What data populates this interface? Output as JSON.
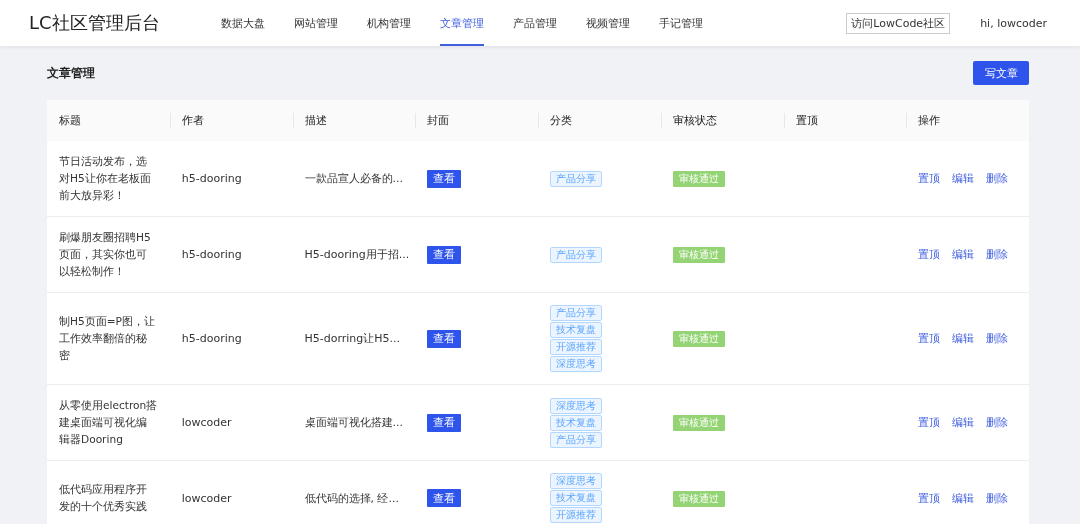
{
  "header": {
    "logo": "LC社区管理后台",
    "nav": [
      {
        "label": "数据大盘",
        "selected": false
      },
      {
        "label": "网站管理",
        "selected": false
      },
      {
        "label": "机构管理",
        "selected": false
      },
      {
        "label": "文章管理",
        "selected": true
      },
      {
        "label": "产品管理",
        "selected": false
      },
      {
        "label": "视频管理",
        "selected": false
      },
      {
        "label": "手记管理",
        "selected": false
      }
    ],
    "visit_button": "访问LowCode社区",
    "greeting": "hi, lowcoder"
  },
  "page": {
    "title": "文章管理",
    "write_button": "写文章"
  },
  "table": {
    "columns": [
      "标题",
      "作者",
      "描述",
      "封面",
      "分类",
      "审核状态",
      "置顶",
      "操作"
    ],
    "rows": [
      {
        "title": "节日活动发布，选对H5让你在老板面前大放异彩！",
        "author": "h5-dooring",
        "description": "一款品宣人必备的...",
        "cover": "查看",
        "categories": [
          "产品分享"
        ],
        "status": "审核通过",
        "actions": [
          "置顶",
          "编辑",
          "删除"
        ]
      },
      {
        "title": "刷爆朋友圈招聘H5页面，其实你也可以轻松制作！",
        "author": "h5-dooring",
        "description": "H5-dooring用于招...",
        "cover": "查看",
        "categories": [
          "产品分享"
        ],
        "status": "审核通过",
        "actions": [
          "置顶",
          "编辑",
          "删除"
        ]
      },
      {
        "title": "制H5页面=P图，让工作效率翻倍的秘密",
        "author": "h5-dooring",
        "description": "H5-dorring让H5...",
        "cover": "查看",
        "categories": [
          "产品分享",
          "技术复盘",
          "开源推荐",
          "深度思考"
        ],
        "status": "审核通过",
        "actions": [
          "置顶",
          "编辑",
          "删除"
        ]
      },
      {
        "title": "从零使用electron搭建桌面端可视化编辑器Dooring",
        "author": "lowcoder",
        "description": "桌面端可视化搭建...",
        "cover": "查看",
        "categories": [
          "深度思考",
          "技术复盘",
          "产品分享"
        ],
        "status": "审核通过",
        "actions": [
          "置顶",
          "编辑",
          "删除"
        ]
      },
      {
        "title": "低代码应用程序开发的十个优秀实践",
        "author": "lowcoder",
        "description": "低代码的选择, 经...",
        "cover": "查看",
        "categories": [
          "深度思考",
          "技术复盘",
          "开源推荐"
        ],
        "status": "审核通过",
        "actions": [
          "置顶",
          "编辑",
          "删除"
        ]
      }
    ]
  }
}
